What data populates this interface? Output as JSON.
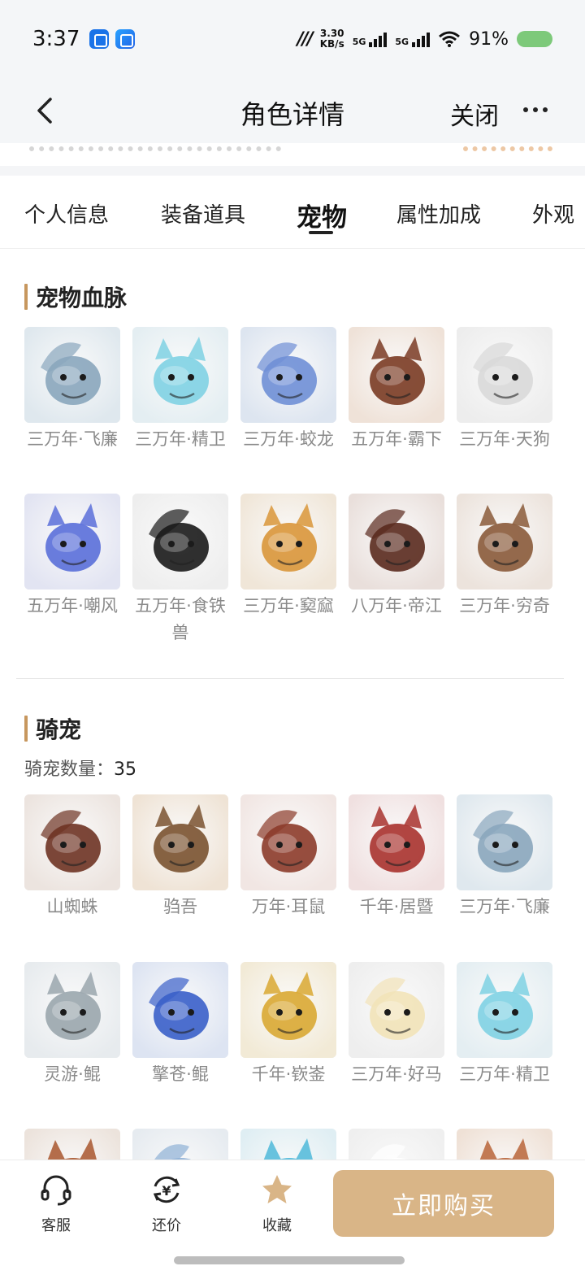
{
  "status_bar": {
    "time": "3:37",
    "net_speed_top": "3.30",
    "net_speed_bottom": "KB/s",
    "sig1_label": "5G",
    "sig2_label": "5G",
    "battery": "91%",
    "mm_logo": "ꟽ"
  },
  "nav": {
    "title": "角色详情",
    "close_label": "关闭"
  },
  "tabs": [
    {
      "label": "个人信息"
    },
    {
      "label": "装备道具"
    },
    {
      "label": "宠物"
    },
    {
      "label": "属性加成"
    },
    {
      "label": "外观"
    }
  ],
  "bloodline": {
    "title": "宠物血脉",
    "items": [
      {
        "name": "三万年·飞廉",
        "color": "#dfe8ee",
        "accent": "#8aa6bd"
      },
      {
        "name": "三万年·精卫",
        "color": "#e4eef2",
        "accent": "#7fd1e3"
      },
      {
        "name": "三万年·蛟龙",
        "color": "#dde5f0",
        "accent": "#6f8fd6"
      },
      {
        "name": "五万年·霸下",
        "color": "#efe2d8",
        "accent": "#7a3b24"
      },
      {
        "name": "三万年·天狗",
        "color": "#ededed",
        "accent": "#d9d9d9"
      },
      {
        "name": "五万年·嘲风",
        "color": "#e2e4f2",
        "accent": "#5a6fd9"
      },
      {
        "name": "五万年·食铁兽",
        "color": "#eeeeee",
        "accent": "#1a1a1a"
      },
      {
        "name": "三万年·窫窳",
        "color": "#f0e6d8",
        "accent": "#d9963a"
      },
      {
        "name": "八万年·帝江",
        "color": "#e9dfdb",
        "accent": "#5a2a1e"
      },
      {
        "name": "三万年·穷奇",
        "color": "#ece3dc",
        "accent": "#8a5a3a"
      }
    ]
  },
  "mounts": {
    "title": "骑宠",
    "count_label": "骑宠数量：",
    "count": "35",
    "items": [
      {
        "name": "山蜘蛛",
        "color": "#ece4df",
        "accent": "#6e3324"
      },
      {
        "name": "驺吾",
        "color": "#efe3d5",
        "accent": "#7a5230"
      },
      {
        "name": "万年·耳鼠",
        "color": "#f1e6e3",
        "accent": "#8c3b2a"
      },
      {
        "name": "千年·居暨",
        "color": "#f0e0e0",
        "accent": "#a8322e"
      },
      {
        "name": "三万年·飞廉",
        "color": "#dfe8ee",
        "accent": "#8aa6bd"
      },
      {
        "name": "灵游·鲲",
        "color": "#e7ebee",
        "accent": "#9aa6ad"
      },
      {
        "name": "擎苍·鲲",
        "color": "#dde4f2",
        "accent": "#3a5fc9"
      },
      {
        "name": "千年·嵚崟",
        "color": "#f2ead6",
        "accent": "#d9a833"
      },
      {
        "name": "三万年·好马",
        "color": "#eeeeee",
        "accent": "#f2e3b8"
      },
      {
        "name": "三万年·精卫",
        "color": "#e4eef2",
        "accent": "#7fd1e3"
      }
    ],
    "partial_row": [
      {
        "color": "#efe0d6",
        "accent": "#a8562e"
      },
      {
        "color": "#e6ebf0",
        "accent": "#8fb0d6"
      },
      {
        "color": "#dfeef3",
        "accent": "#4fb8d9"
      },
      {
        "color": "#efefef",
        "accent": "#ffffff"
      },
      {
        "color": "#efe1d6",
        "accent": "#b8653a"
      }
    ]
  },
  "bottom_bar": {
    "service_label": "客服",
    "bargain_label": "还价",
    "favorite_label": "收藏",
    "buy_label": "立即购买",
    "favorite_color": "#d9b587"
  }
}
